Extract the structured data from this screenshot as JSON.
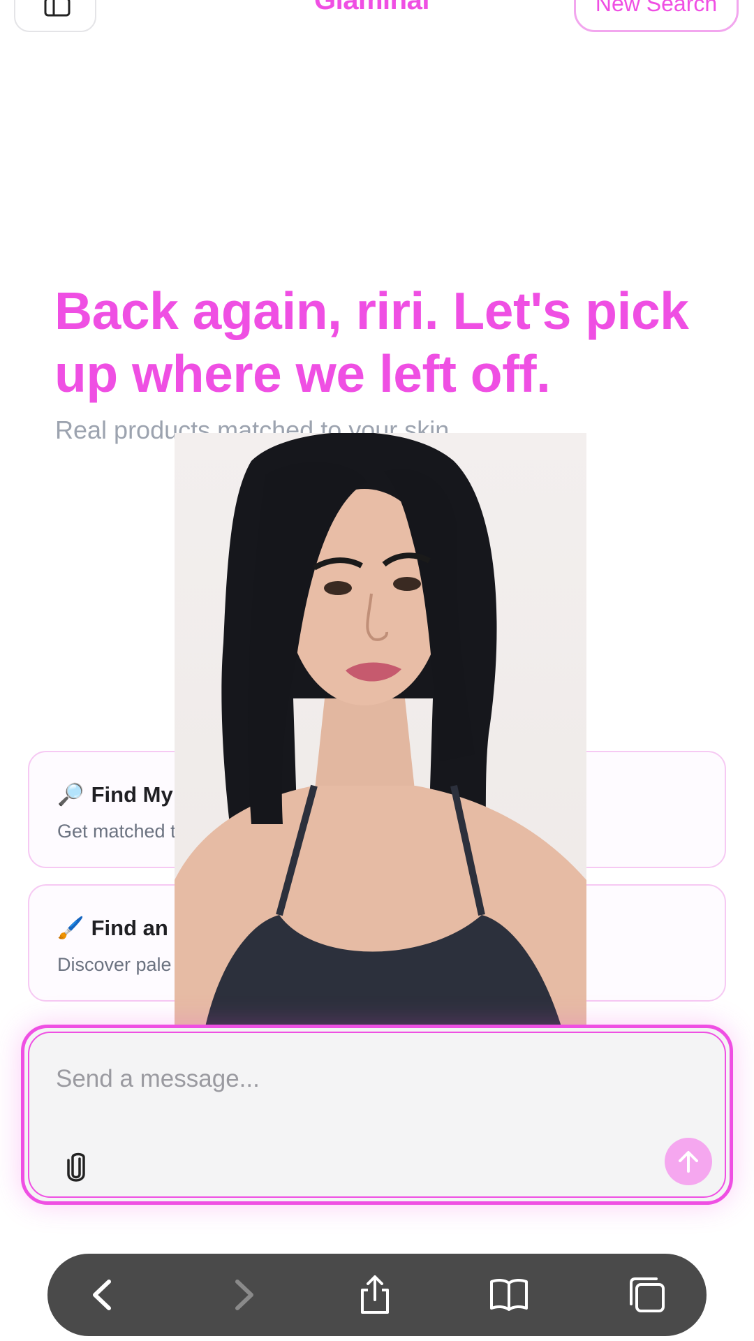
{
  "header": {
    "brand": "Glaminal",
    "new_search_label": "New Search",
    "sidebar_icon": "sidebar-toggle-icon"
  },
  "hero": {
    "title": "Back again, riri. Let's pick up where we left off.",
    "subtitle": "Real products matched to your skin."
  },
  "cards": [
    {
      "emoji": "🔎",
      "title": "Find My Fo",
      "description": "Get matched t"
    },
    {
      "emoji": "🖌️",
      "title": "Find an",
      "description": "Discover pale"
    }
  ],
  "composer": {
    "placeholder": "Send a message...",
    "attach_icon": "paperclip-icon",
    "send_icon": "arrow-up-icon"
  },
  "browser_toolbar": {
    "items": [
      "chevron-left-icon",
      "chevron-right-icon",
      "share-icon",
      "bookmarks-icon",
      "tabs-icon"
    ]
  },
  "colors": {
    "accent": "#ef4fe3",
    "accent_soft": "#f5a7ef",
    "toolbar_bg": "#4a4a4a"
  }
}
